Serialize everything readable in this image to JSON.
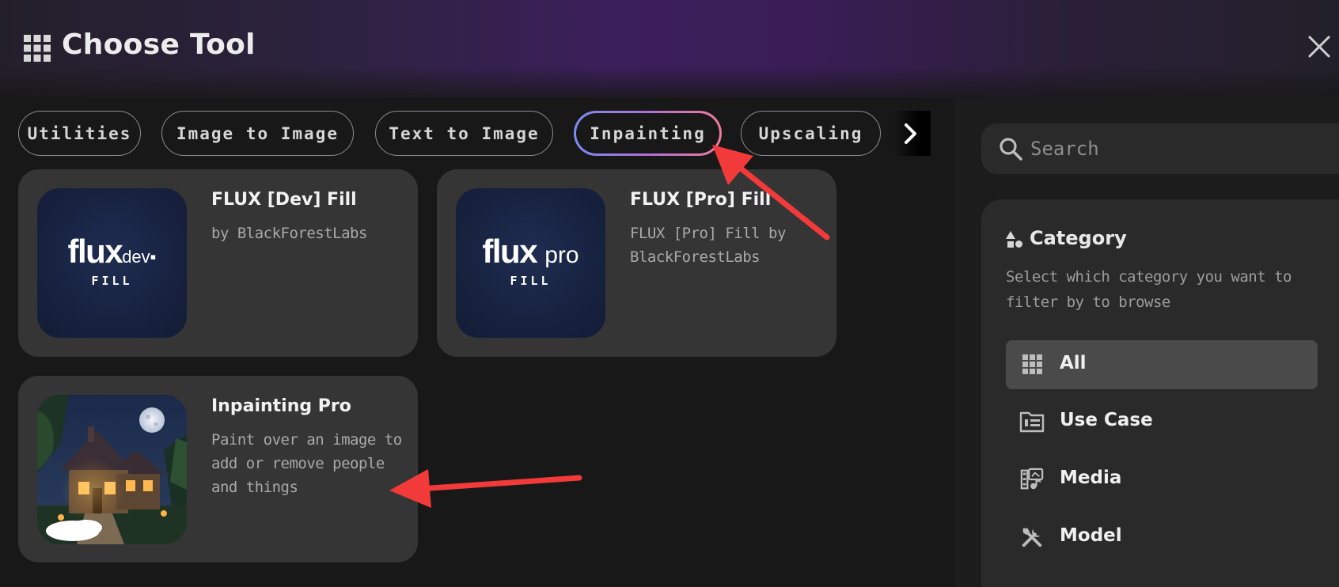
{
  "header": {
    "title": "Choose Tool",
    "grid_icon": "grid-icon",
    "close_icon": "close-icon"
  },
  "tabs": [
    {
      "label": "Utilities",
      "active": false
    },
    {
      "label": "Image to Image",
      "active": false
    },
    {
      "label": "Text to Image",
      "active": false
    },
    {
      "label": "Inpainting",
      "active": true
    },
    {
      "label": "Upscaling",
      "active": false
    }
  ],
  "tools": [
    {
      "name": "FLUX [Dev] Fill",
      "description": "by BlackForestLabs",
      "logo_word": "flux",
      "logo_suffix": "dev",
      "logo_sub": "FILL"
    },
    {
      "name": "FLUX [Pro] Fill",
      "description": "FLUX [Pro] Fill by BlackForestLabs",
      "logo_word": "flux",
      "logo_suffix": "pro",
      "logo_sub": "FILL"
    },
    {
      "name": "Inpainting Pro",
      "description": "Paint over an image to add or remove people and things"
    }
  ],
  "search": {
    "placeholder": "Search",
    "value": ""
  },
  "category": {
    "title": "Category",
    "description": "Select which category you want to filter by to browse",
    "items": [
      {
        "label": "All",
        "icon": "grid-icon",
        "active": true
      },
      {
        "label": "Use Case",
        "icon": "folder-icon",
        "active": false
      },
      {
        "label": "Media",
        "icon": "media-icon",
        "active": false
      },
      {
        "label": "Model",
        "icon": "tools-icon",
        "active": false
      }
    ]
  },
  "colors": {
    "annotation_arrow": "#f23a3a",
    "card_bg": "#353535",
    "active_tab_gradient": [
      "#7b8cf0",
      "#b06fd6",
      "#f07a9a"
    ]
  }
}
